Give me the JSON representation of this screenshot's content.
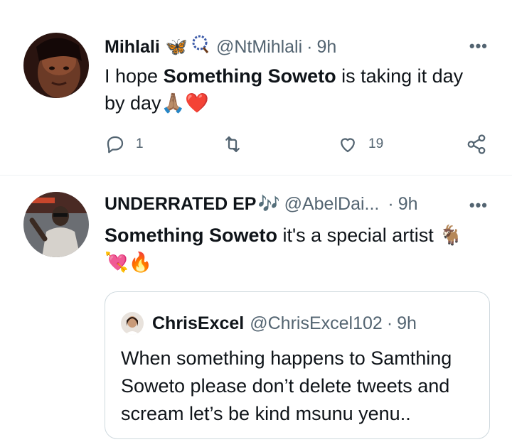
{
  "tweets": [
    {
      "name": "Mihlali",
      "name_emojis": "🦋",
      "handle": "@NtMihlali",
      "separator": "·",
      "time": "9h",
      "more": "•••",
      "text_before": "I hope ",
      "text_bold": "Something Soweto",
      "text_after": " is taking it day by day",
      "text_emojis": "🙏🏽❤️",
      "actions": {
        "replies": "1",
        "retweets": "",
        "likes": "19"
      }
    },
    {
      "name": "UNDERRATED EP",
      "name_emojis": "🎶",
      "handle": "@AbelDai...",
      "separator": "·",
      "time": "9h",
      "more": "•••",
      "text_bold": "Something Soweto",
      "text_after": " it's a special artist ",
      "text_emojis": "🐐 💘🔥"
    }
  ],
  "quote": {
    "name": "ChrisExcel",
    "handle": "@ChrisExcel102",
    "separator": "·",
    "time": "9h",
    "text": "When something happens to Samthing Soweto please don’t delete tweets and scream let’s be kind msunu yenu.."
  },
  "colors": {
    "secondary": "#536471",
    "text": "#0f1419",
    "heart": "#e0245e",
    "border": "#cfd9de"
  }
}
